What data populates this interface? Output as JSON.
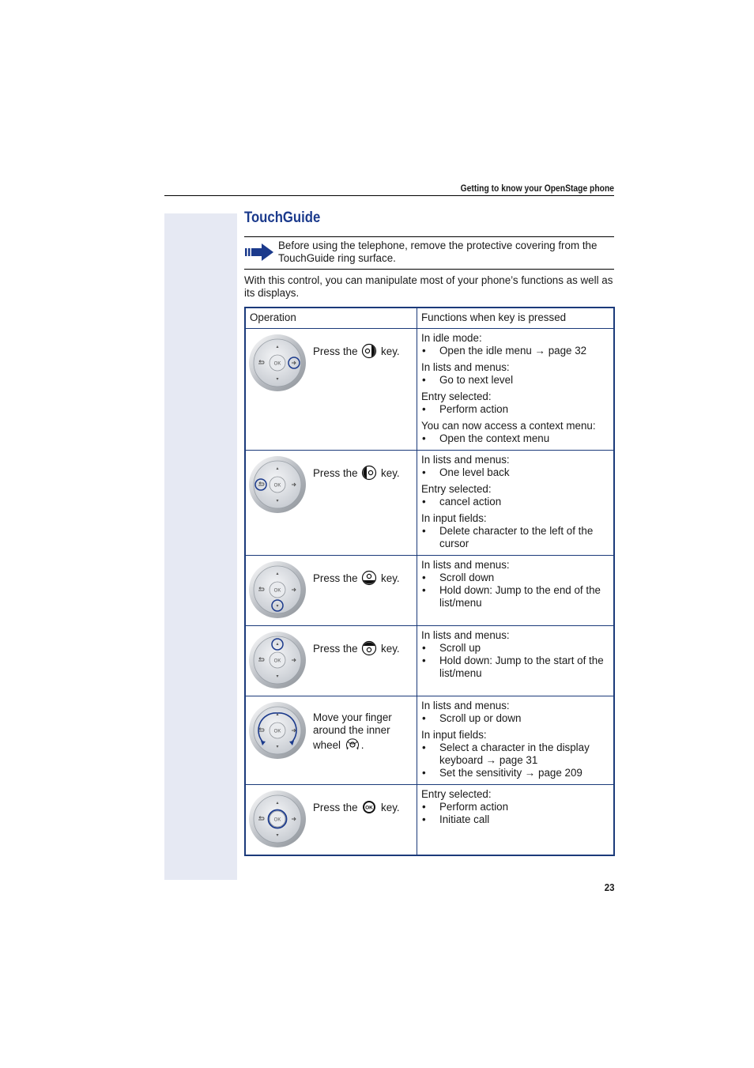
{
  "running_header": "Getting to know your OpenStage phone",
  "page_title": "TouchGuide",
  "note": {
    "icon": "arrow-right-icon",
    "text": "Before using the telephone, remove the protective covering from the TouchGuide ring surface."
  },
  "intro": "With this control, you can manipulate most of your phone’s functions as well as its displays.",
  "colors": {
    "accent": "#1b3a8c",
    "table_border": "#1b3a7a",
    "sidebar": "#e6e9f3"
  },
  "table": {
    "headers": [
      "Operation",
      "Functions when key is pressed"
    ],
    "rows": [
      {
        "highlight": "right-key",
        "key_icon": "right-key-icon",
        "op_before": "Press the",
        "op_after": "key.",
        "groups": [
          {
            "title": "In idle mode:",
            "items": [
              "Open the idle menu → page 32"
            ]
          },
          {
            "title": "In lists and menus:",
            "items": [
              "Go to next level"
            ]
          },
          {
            "title": "Entry selected:",
            "items": [
              "Perform action"
            ]
          },
          {
            "title": "You can now access a context menu:",
            "items": [
              "Open the context menu"
            ]
          }
        ]
      },
      {
        "highlight": "back-key",
        "key_icon": "left-key-icon",
        "op_before": "Press the",
        "op_after": "key.",
        "groups": [
          {
            "title": "In lists and menus:",
            "items": [
              "One level back"
            ]
          },
          {
            "title": "Entry selected:",
            "items": [
              "cancel action"
            ]
          },
          {
            "title": "In input fields:",
            "items": [
              "Delete character to the left of the cursor"
            ]
          }
        ]
      },
      {
        "highlight": "down-key",
        "key_icon": "down-key-icon",
        "op_before": "Press the",
        "op_after": "key.",
        "groups": [
          {
            "title": "In lists and menus:",
            "items": [
              "Scroll down",
              "Hold down: Jump to the end of the list/menu"
            ]
          }
        ]
      },
      {
        "highlight": "up-key",
        "key_icon": "up-key-icon",
        "op_before": "Press the",
        "op_after": "key.",
        "groups": [
          {
            "title": "In lists and menus:",
            "items": [
              "Scroll up",
              "Hold down: Jump to the start of the list/menu"
            ]
          }
        ]
      },
      {
        "highlight": "wheel",
        "key_icon": "inner-wheel-icon",
        "op_before": "Move your finger around the inner wheel",
        "op_after": ".",
        "groups": [
          {
            "title": "In lists and menus:",
            "items": [
              "Scroll up or down"
            ]
          },
          {
            "title": "In input fields:",
            "items": [
              "Select a character in the display keyboard → page 31",
              "Set the sensitivity → page 209"
            ]
          }
        ]
      },
      {
        "highlight": "ok-key",
        "key_icon": "ok-key-icon",
        "op_before": "Press the",
        "op_after": "key.",
        "groups": [
          {
            "title": "Entry selected:",
            "items": [
              "Perform action",
              "Initiate call"
            ]
          }
        ]
      }
    ]
  },
  "wheel_labels": {
    "ok": "OK"
  },
  "page_number": "23"
}
